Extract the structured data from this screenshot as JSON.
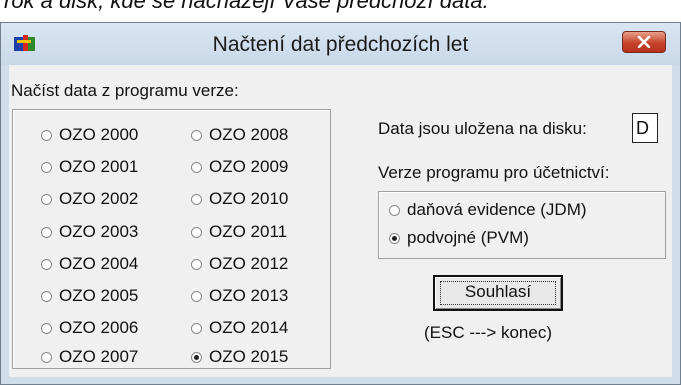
{
  "doc_fragment": "rok a disk, kde se nacházejí Vaše předchozí data.",
  "window": {
    "title": "Načtení dat předchozích let"
  },
  "left": {
    "label": "Načíst data z programu verze:",
    "versions_col1": [
      "OZO 2000",
      "OZO 2001",
      "OZO 2002",
      "OZO 2003",
      "OZO 2004",
      "OZO 2005",
      "OZO 2006",
      "OZO 2007"
    ],
    "versions_col2": [
      "OZO 2008",
      "OZO 2009",
      "OZO 2010",
      "OZO 2011",
      "OZO 2012",
      "OZO 2013",
      "OZO 2014",
      "OZO 2015"
    ],
    "selected": "OZO 2015"
  },
  "right": {
    "disk_label": "Data jsou uložena na disku:",
    "disk_value": "D",
    "accounting_label": "Verze programu pro účetnictví:",
    "options": [
      "daňová evidence (JDM)",
      "podvojné (PVM)"
    ],
    "selected_option": "podvojné (PVM)",
    "agree_button": "Souhlasí",
    "esc_hint": "(ESC ---> konec)"
  },
  "colors": {
    "close_button": "#c6432c",
    "titlebar": "#d0deec",
    "client": "#f0f0f0"
  }
}
